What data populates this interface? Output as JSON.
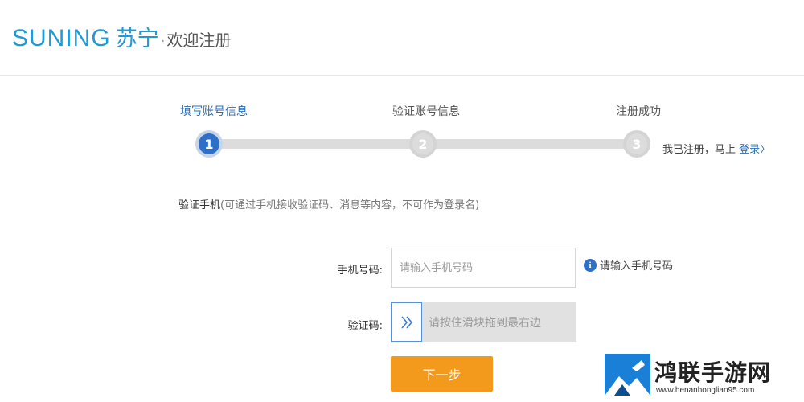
{
  "header": {
    "brand_en": "SUNING",
    "brand_cn": "苏宁",
    "separator": "·",
    "page_title": "欢迎注册"
  },
  "steps": [
    {
      "label": "填写账号信息",
      "number": "1",
      "active": true
    },
    {
      "label": "验证账号信息",
      "number": "2",
      "active": false
    },
    {
      "label": "注册成功",
      "number": "3",
      "active": false
    }
  ],
  "login_hint": {
    "text": "我已注册，马上",
    "link": "登录",
    "chevron": "〉"
  },
  "verify_section": {
    "title": "验证手机",
    "note": "(可通过手机接收验证码、消息等内容，不可作为登录名)"
  },
  "form": {
    "phone_label": "手机号码:",
    "phone_placeholder": "请输入手机号码",
    "phone_hint": "请输入手机号码",
    "captcha_label": "验证码:",
    "slider_text": "请按住滑块拖到最右边",
    "next_button": "下一步"
  },
  "watermark": {
    "title": "鸿联手游网",
    "url": "www.henanhonglian95.com"
  },
  "colors": {
    "brand_blue": "#1e9bd7",
    "step_active": "#2e6fc7",
    "button_orange": "#f39a1c",
    "link_blue": "#2b6cb0"
  }
}
